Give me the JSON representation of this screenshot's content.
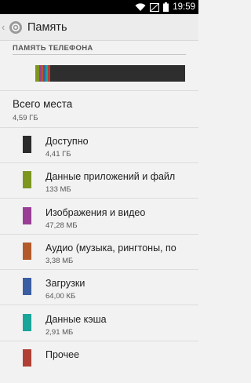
{
  "status_bar": {
    "time": "19:59"
  },
  "header": {
    "title": "Память"
  },
  "section": {
    "title": "ПАМЯТЬ ТЕЛЕФОНА"
  },
  "total": {
    "label": "Всего места",
    "value": "4,59 ГБ"
  },
  "items": [
    {
      "label": "Доступно",
      "value": "4,41 ГБ",
      "color": "#2b2b2b"
    },
    {
      "label": "Данные приложений и файл",
      "value": "133 МБ",
      "color": "#7d9620"
    },
    {
      "label": "Изображения и видео",
      "value": "47,28 МБ",
      "color": "#993e96"
    },
    {
      "label": "Аудио (музыка, рингтоны, по",
      "value": "3,38 МБ",
      "color": "#b35a2a"
    },
    {
      "label": "Загрузки",
      "value": "64,00 КБ",
      "color": "#3b5ea3"
    },
    {
      "label": "Данные кэша",
      "value": "2,91 МБ",
      "color": "#1aa59a"
    },
    {
      "label": "Прочее",
      "value": "",
      "color": "#b04035"
    }
  ],
  "usage_bar": [
    {
      "name": "apps",
      "color": "#7d9620",
      "percent": 2.8
    },
    {
      "name": "media",
      "color": "#993e96",
      "percent": 1.5
    },
    {
      "name": "audio",
      "color": "#b35a2a",
      "percent": 1.0
    },
    {
      "name": "downloads",
      "color": "#3b5ea3",
      "percent": 1.3
    },
    {
      "name": "cache",
      "color": "#1aa59a",
      "percent": 1.8
    },
    {
      "name": "misc",
      "color": "#b04035",
      "percent": 1.4
    }
  ]
}
